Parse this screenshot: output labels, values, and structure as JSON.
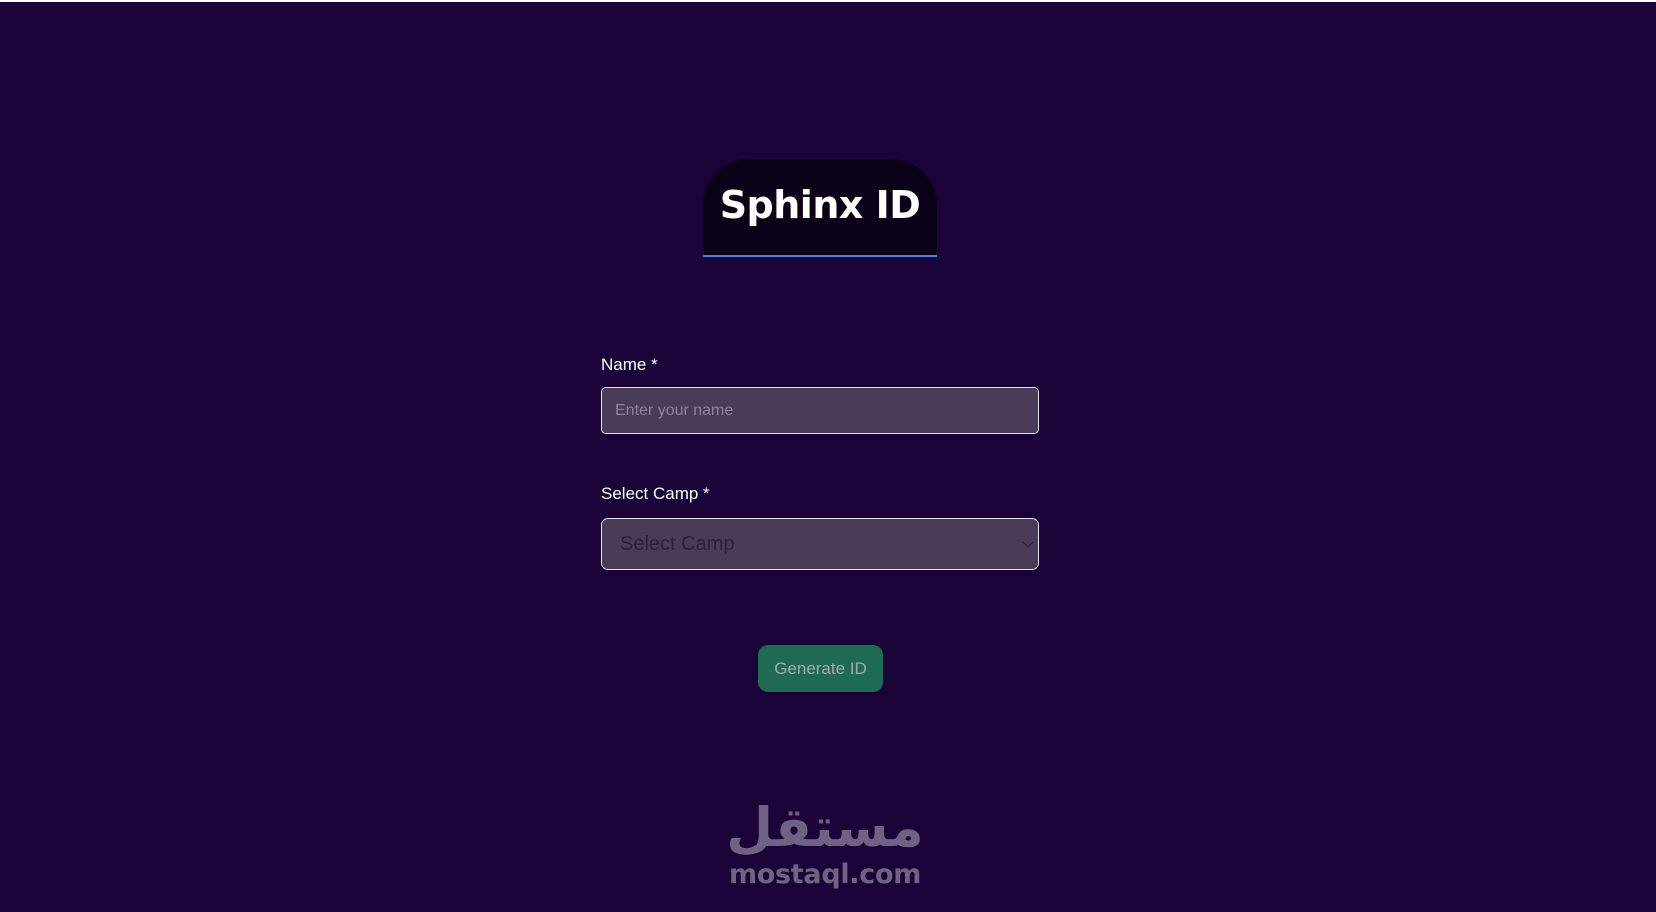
{
  "header": {
    "title": "Sphinx ID"
  },
  "form": {
    "name_label": "Name *",
    "name_placeholder": "Enter your name",
    "name_value": "",
    "camp_label": "Select Camp *",
    "camp_selected": "Select Camp",
    "submit_label": "Generate ID"
  },
  "watermark": {
    "arabic_text": "مستقل",
    "site_text": "mostaql.com"
  },
  "colors": {
    "background": "#1a0336",
    "title_card": "#0b0218",
    "title_underline": "#4a84e6",
    "field_background": "#4a3c59",
    "button_background": "#1f6a52"
  },
  "icons": {
    "select_arrow": "chevron-down-icon"
  }
}
